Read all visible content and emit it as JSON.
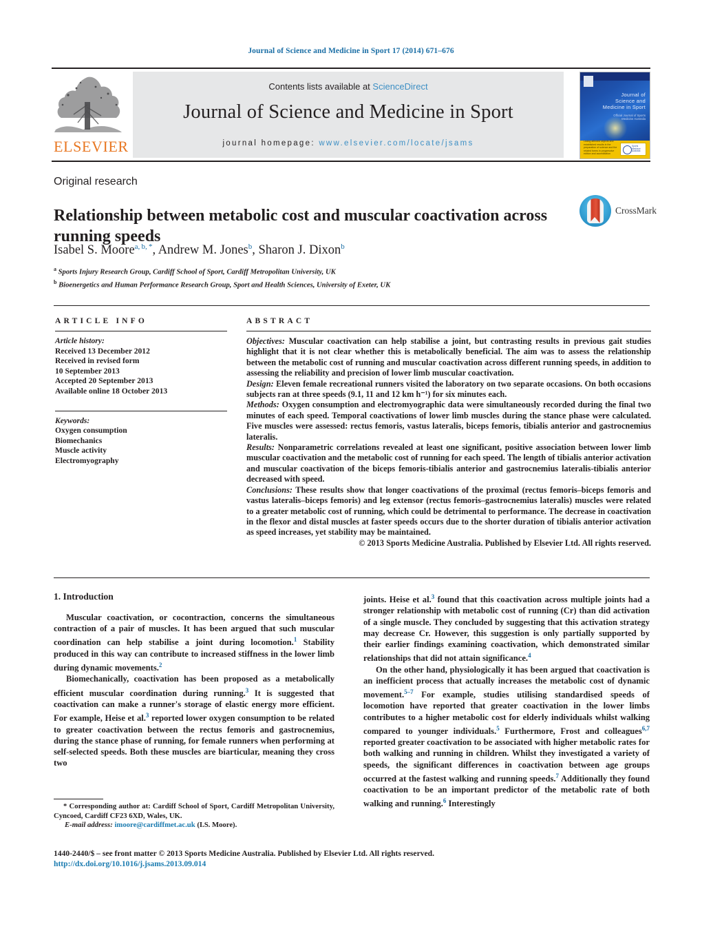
{
  "running_head": "Journal of Science and Medicine in Sport 17 (2014) 671–676",
  "masthead": {
    "elsevier_wordmark": "ELSEVIER",
    "contents_prefix": "Contents lists available at ",
    "sciencedirect": "ScienceDirect",
    "journal_title": "Journal of Science and Medicine in Sport",
    "homepage_prefix": "journal homepage:",
    "homepage_url": "www.elsevier.com/locate/jsams",
    "cover": {
      "title": "Journal of Science and Medicine in Sport",
      "subtitle": "Official Journal of Sports Medicine Australia",
      "footer_text": "Listing affected objects and established results in the preparation of science and the related forms in progressive edition and accreditation",
      "badge_text": "Sports Medicine Australia"
    }
  },
  "article": {
    "kind": "Original research",
    "title": "Relationship between metabolic cost and muscular coactivation across running speeds",
    "crossmark_label": "CrossMark",
    "authors_html": "Isabel S. Moore<sup>a, b, *</sup>, Andrew M. Jones<sup>b</sup>, Sharon J. Dixon<sup>b</sup>",
    "affiliation_a": "Sports Injury Research Group, Cardiff School of Sport, Cardiff Metropolitan University, UK",
    "affiliation_b": "Bioenergetics and Human Performance Research Group, Sport and Health Sciences, University of Exeter, UK"
  },
  "article_info": {
    "heading": "ARTICLE INFO",
    "history_label": "Article history:",
    "history": [
      "Received 13 December 2012",
      "Received in revised form",
      "10 September 2013",
      "Accepted 20 September 2013",
      "Available online 18 October 2013"
    ],
    "keywords_label": "Keywords:",
    "keywords": [
      "Oxygen consumption",
      "Biomechanics",
      "Muscle activity",
      "Electromyography"
    ]
  },
  "abstract": {
    "heading": "ABSTRACT",
    "objectives_label": "Objectives:",
    "objectives": " Muscular coactivation can help stabilise a joint, but contrasting results in previous gait studies highlight that it is not clear whether this is metabolically beneficial. The aim was to assess the relationship between the metabolic cost of running and muscular coactivation across different running speeds, in addition to assessing the reliability and precision of lower limb muscular coactivation.",
    "design_label": "Design:",
    "design": " Eleven female recreational runners visited the laboratory on two separate occasions. On both occasions subjects ran at three speeds (9.1, 11 and 12 km h⁻¹) for six minutes each.",
    "methods_label": "Methods:",
    "methods": " Oxygen consumption and electromyographic data were simultaneously recorded during the final two minutes of each speed. Temporal coactivations of lower limb muscles during the stance phase were calculated. Five muscles were assessed: rectus femoris, vastus lateralis, biceps femoris, tibialis anterior and gastrocnemius lateralis.",
    "results_label": "Results:",
    "results": " Nonparametric correlations revealed at least one significant, positive association between lower limb muscular coactivation and the metabolic cost of running for each speed. The length of tibialis anterior activation and muscular coactivation of the biceps femoris-tibialis anterior and gastrocnemius lateralis-tibialis anterior decreased with speed.",
    "conclusions_label": "Conclusions:",
    "conclusions": " These results show that longer coactivations of the proximal (rectus femoris–biceps femoris and vastus lateralis–biceps femoris) and leg extensor (rectus femoris–gastrocnemius lateralis) muscles were related to a greater metabolic cost of running, which could be detrimental to performance. The decrease in coactivation in the flexor and distal muscles at faster speeds occurs due to the shorter duration of tibialis anterior activation as speed increases, yet stability may be maintained.",
    "copyright": "© 2013 Sports Medicine Australia. Published by Elsevier Ltd. All rights reserved."
  },
  "introduction": {
    "heading": "1.  Introduction",
    "left_p1_a": "Muscular coactivation, or cocontraction, concerns the simultaneous contraction of a pair of muscles. It has been argued that such muscular coordination can help stabilise a joint during locomotion.",
    "left_p1_sup1": "1",
    "left_p1_b": " Stability produced in this way can contribute to increased stiffness in the lower limb during dynamic movements.",
    "left_p1_sup2": "2",
    "left_p2_a": "Biomechanically, coactivation has been proposed as a metabolically efficient muscular coordination during running.",
    "left_p2_sup1": "3",
    "left_p2_b": " It is suggested that coactivation can make a runner's storage of elastic energy more efficient. For example, Heise et al.",
    "left_p2_sup2": "3",
    "left_p2_c": " reported lower oxygen consumption to be related to greater coactivation between the rectus femoris and gastrocnemius, during the stance phase of running, for female runners when performing at self-selected speeds. Both these muscles are biarticular, meaning they cross two",
    "right_p1_a": "joints. Heise et al.",
    "right_p1_sup1": "3",
    "right_p1_b": " found that this coactivation across multiple joints had a stronger relationship with metabolic cost of running (Cr) than did activation of a single muscle. They concluded by suggesting that this activation strategy may decrease Cr. However, this suggestion is only partially supported by their earlier findings examining coactivation, which demonstrated similar relationships that did not attain significance.",
    "right_p1_sup2": "4",
    "right_p2_a": "On the other hand, physiologically it has been argued that coactivation is an inefficient process that actually increases the metabolic cost of dynamic movement.",
    "right_p2_sup1": "5–7",
    "right_p2_b": " For example, studies utilising standardised speeds of locomotion have reported that greater coactivation in the lower limbs contributes to a higher metabolic cost for elderly individuals whilst walking compared to younger individuals.",
    "right_p2_sup2": "5",
    "right_p2_c": " Furthermore, Frost and colleagues",
    "right_p2_sup3": "6,7",
    "right_p2_d": " reported greater coactivation to be associated with higher metabolic rates for both walking and running in children. Whilst they investigated a variety of speeds, the significant differences in coactivation between age groups occurred at the fastest walking and running speeds.",
    "right_p2_sup4": "7",
    "right_p2_e": " Additionally they found coactivation to be an important predictor of the metabolic rate of both walking and running.",
    "right_p2_sup5": "6",
    "right_p2_f": " Interestingly"
  },
  "footnote": {
    "star": "*",
    "corresponding": " Corresponding author at: Cardiff School of Sport, Cardiff Metropolitan University, Cyncoed, Cardiff CF23 6XD, Wales, UK.",
    "email_label": "E-mail address:",
    "email": "imoore@cardiffmet.ac.uk",
    "email_suffix": " (I.S. Moore)."
  },
  "publisher_footer": {
    "line": "1440-2440/$ – see front matter © 2013 Sports Medicine Australia. Published by Elsevier Ltd. All rights reserved.",
    "doi": "http://dx.doi.org/10.1016/j.jsams.2013.09.014"
  },
  "colors": {
    "link_blue": "#1a7bb0",
    "sciencedirect_blue": "#3d8fc4",
    "elsevier_orange": "#e87722",
    "panel_grey": "#e6e7e8"
  }
}
